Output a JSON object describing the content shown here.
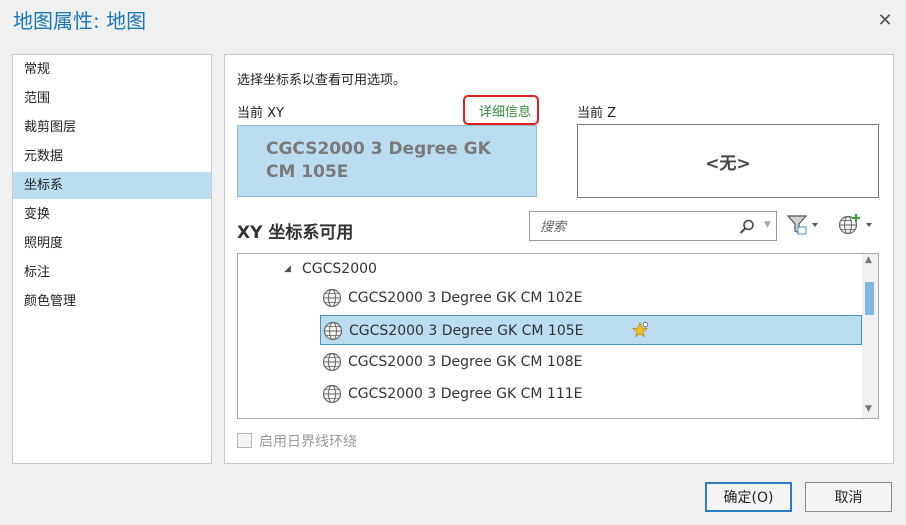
{
  "window": {
    "title": "地图属性: 地图"
  },
  "sidebar": {
    "items": [
      {
        "label": "常规"
      },
      {
        "label": "范围"
      },
      {
        "label": "裁剪图层"
      },
      {
        "label": "元数据"
      },
      {
        "label": "坐标系",
        "selected": true
      },
      {
        "label": "变换"
      },
      {
        "label": "照明度"
      },
      {
        "label": "标注"
      },
      {
        "label": "颜色管理"
      }
    ]
  },
  "main": {
    "instruction": "选择坐标系以查看可用选项。",
    "current_xy_label": "当前 XY",
    "details_link": "详细信息",
    "current_z_label": "当前 Z",
    "current_xy_value": "CGCS2000 3 Degree GK CM 105E",
    "current_z_value": "<无>",
    "available_title": "XY 坐标系可用",
    "search": {
      "placeholder": "搜索",
      "value": ""
    },
    "tree": {
      "group": "CGCS2000",
      "items": [
        {
          "label": "CGCS2000 3 Degree GK CM 102E",
          "selected": false
        },
        {
          "label": "CGCS2000 3 Degree GK CM 105E",
          "selected": true
        },
        {
          "label": "CGCS2000 3 Degree GK CM 108E",
          "selected": false
        },
        {
          "label": "CGCS2000 3 Degree GK CM 111E",
          "selected": false
        }
      ]
    },
    "dateline_checkbox": {
      "label": "启用日界线环绕",
      "checked": false,
      "enabled": false
    }
  },
  "buttons": {
    "ok": "确定(O)",
    "cancel": "取消"
  },
  "colors": {
    "title": "#1c76b9",
    "selection": "#bcdcf0",
    "details_link": "#2f8a3b",
    "highlight_box": "#e02020",
    "ok_border": "#2d7bc5"
  },
  "icons": [
    "close-icon",
    "search-icon",
    "chevron-down-icon",
    "filter-icon",
    "globe-add-icon",
    "globe-icon",
    "favorite-star-icon",
    "expand-arrow-icon"
  ]
}
